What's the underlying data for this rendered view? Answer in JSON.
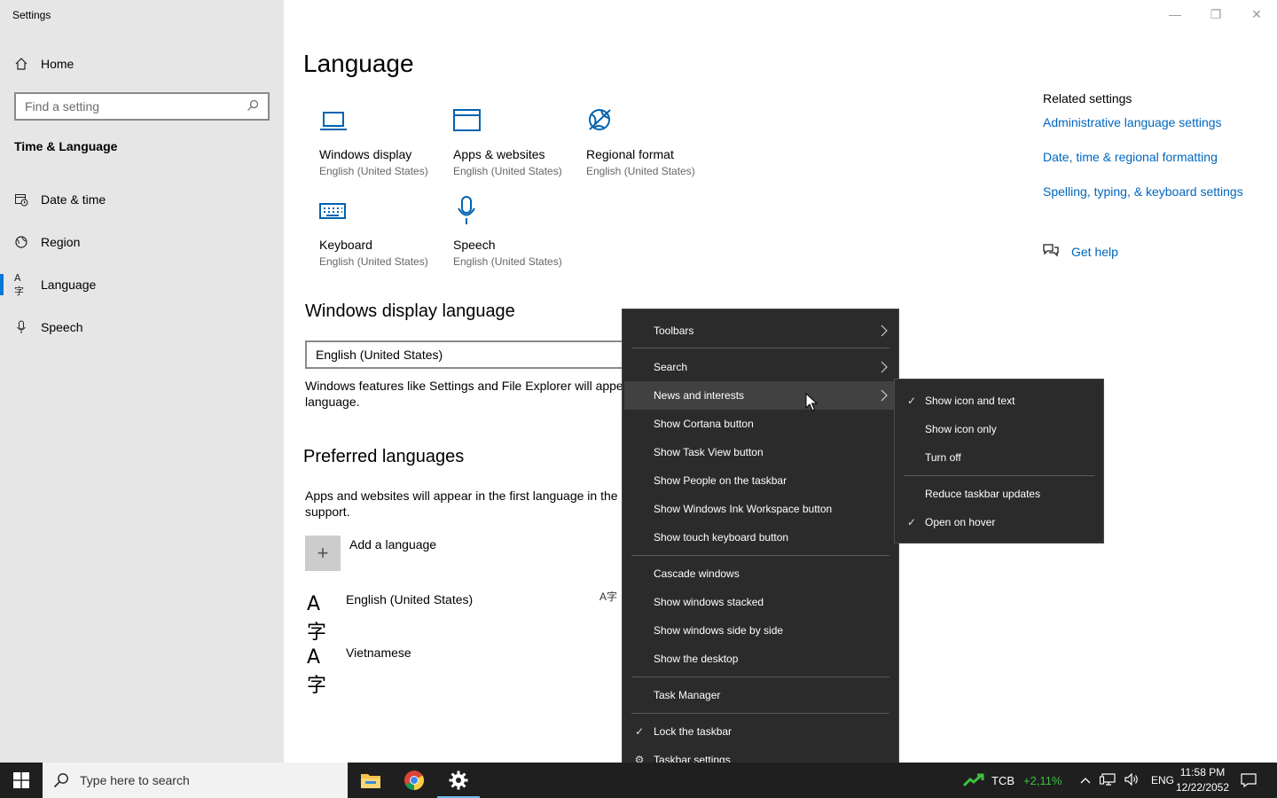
{
  "window": {
    "title": "Settings",
    "minimize_icon": "minimize-icon",
    "restore_icon": "restore-icon",
    "close_icon": "close-icon"
  },
  "sidebar": {
    "home": "Home",
    "search_placeholder": "Find a setting",
    "section": "Time & Language",
    "items": [
      {
        "label": "Date & time",
        "icon": "date-time-icon"
      },
      {
        "label": "Region",
        "icon": "region-icon"
      },
      {
        "label": "Language",
        "icon": "language-icon",
        "active": true
      },
      {
        "label": "Speech",
        "icon": "microphone-icon"
      }
    ]
  },
  "main": {
    "title": "Language",
    "tiles": [
      {
        "name": "Windows display",
        "sub": "English (United States)",
        "icon": "laptop-icon"
      },
      {
        "name": "Apps & websites",
        "sub": "English (United States)",
        "icon": "app-window-icon"
      },
      {
        "name": "Regional format",
        "sub": "English (United States)",
        "icon": "globe-icon"
      },
      {
        "name": "Keyboard",
        "sub": "English (United States)",
        "icon": "keyboard-icon"
      },
      {
        "name": "Speech",
        "sub": "English (United States)",
        "icon": "microphone-icon"
      }
    ],
    "display_language": {
      "heading": "Windows display language",
      "value": "English (United States)",
      "description_line1": "Windows features like Settings and File Explorer will appea",
      "description_line2": "language."
    },
    "preferred": {
      "heading": "Preferred languages",
      "description_line1": "Apps and websites will appear in the first language in the",
      "description_line2": "support.",
      "add_label": "Add a language",
      "languages": [
        "English (United States)",
        "Vietnamese"
      ]
    },
    "related": {
      "title": "Related settings",
      "links": [
        "Administrative language settings",
        "Date, time & regional formatting",
        "Spelling, typing, & keyboard settings"
      ],
      "help": "Get help"
    }
  },
  "context_menu": {
    "items": [
      {
        "label": "Toolbars",
        "submenu": true
      },
      {
        "label": "Search",
        "submenu": true
      },
      {
        "label": "News and interests",
        "submenu": true,
        "highlighted": true
      },
      {
        "label": "Show Cortana button"
      },
      {
        "label": "Show Task View button"
      },
      {
        "label": "Show People on the taskbar"
      },
      {
        "label": "Show Windows Ink Workspace button"
      },
      {
        "label": "Show touch keyboard button"
      },
      {
        "label": "Cascade windows"
      },
      {
        "label": "Show windows stacked"
      },
      {
        "label": "Show windows side by side"
      },
      {
        "label": "Show the desktop"
      },
      {
        "label": "Task Manager"
      },
      {
        "label": "Lock the taskbar",
        "checked": true
      },
      {
        "label": "Taskbar settings",
        "icon": "gear-icon"
      }
    ]
  },
  "submenu": {
    "items": [
      {
        "label": "Show icon and text",
        "checked": true
      },
      {
        "label": "Show icon only"
      },
      {
        "label": "Turn off"
      },
      {
        "label": "Reduce taskbar updates"
      },
      {
        "label": "Open on hover",
        "checked": true
      }
    ]
  },
  "taskbar": {
    "search_placeholder": "Type here to search",
    "stock_symbol": "TCB",
    "stock_change": "+2,11%",
    "stock_color": "#3ec13e",
    "language": "ENG",
    "time": "11:58 PM",
    "date": "12/22/2052"
  }
}
